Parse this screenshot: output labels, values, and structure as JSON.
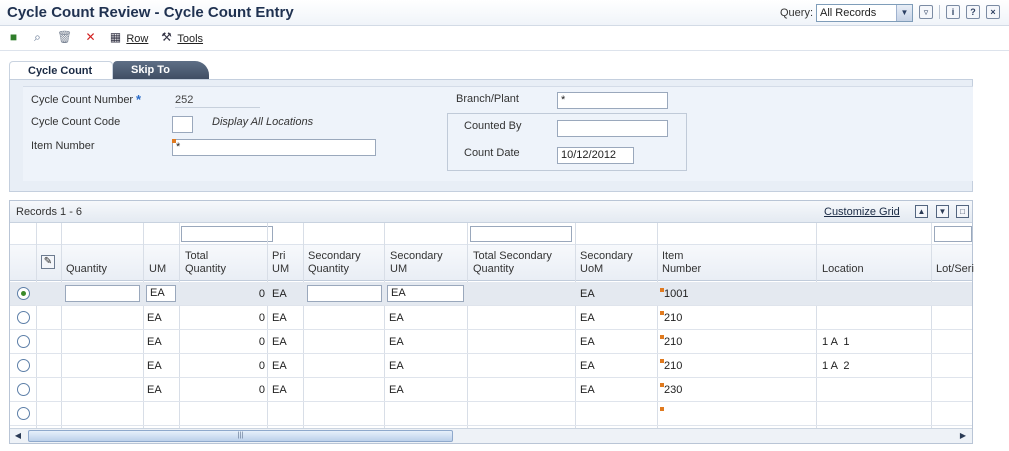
{
  "header": {
    "title": "Cycle Count Review - Cycle Count Entry",
    "query_label": "Query:",
    "query_value": "All Records"
  },
  "toolbar": {
    "row_label": "Row",
    "tools_label": "Tools"
  },
  "tabs": [
    {
      "label": "Cycle Count"
    },
    {
      "label": "Skip To"
    }
  ],
  "form": {
    "cycle_count_number_label": "Cycle Count Number",
    "cycle_count_number_value": "252",
    "cycle_count_code_label": "Cycle Count Code",
    "display_all_locations": "Display All Locations",
    "item_number_label": "Item Number",
    "item_number_value": "*",
    "branch_plant_label": "Branch/Plant",
    "branch_plant_value": "*",
    "counted_by_label": "Counted By",
    "count_date_label": "Count Date",
    "count_date_value": "10/12/2012"
  },
  "grid": {
    "records_label": "Records 1 - 6",
    "customize_label": "Customize Grid",
    "columns": [
      {
        "l1": "",
        "l2": "Quantity"
      },
      {
        "l1": "",
        "l2": "UM"
      },
      {
        "l1": "Total",
        "l2": "Quantity"
      },
      {
        "l1": "Pri",
        "l2": "UM"
      },
      {
        "l1": "Secondary",
        "l2": "Quantity"
      },
      {
        "l1": "Secondary",
        "l2": "UM"
      },
      {
        "l1": "Total Secondary",
        "l2": "Quantity"
      },
      {
        "l1": "Secondary",
        "l2": "UoM"
      },
      {
        "l1": "Item",
        "l2": "Number"
      },
      {
        "l1": "",
        "l2": "Location"
      },
      {
        "l1": "",
        "l2": "Lot/Seri"
      }
    ],
    "rows": [
      {
        "um": "EA",
        "total": "0",
        "pri_um": "EA",
        "sec_um": "EA",
        "sec_uom": "EA",
        "item": "1001",
        "location": ""
      },
      {
        "um": "EA",
        "total": "0",
        "pri_um": "EA",
        "sec_um": "EA",
        "sec_uom": "EA",
        "item": "210",
        "location": ""
      },
      {
        "um": "EA",
        "total": "0",
        "pri_um": "EA",
        "sec_um": "EA",
        "sec_uom": "EA",
        "item": "210",
        "location": "1 A  1"
      },
      {
        "um": "EA",
        "total": "0",
        "pri_um": "EA",
        "sec_um": "EA",
        "sec_uom": "EA",
        "item": "210",
        "location": "1 A  2"
      },
      {
        "um": "EA",
        "total": "0",
        "pri_um": "EA",
        "sec_um": "EA",
        "sec_uom": "EA",
        "item": "230",
        "location": ""
      },
      {
        "um": "",
        "total": "",
        "pri_um": "",
        "sec_um": "",
        "sec_uom": "",
        "item": "",
        "location": ""
      }
    ]
  },
  "colors": {
    "title": "#1f3150",
    "accent": "#2a6bc7",
    "qbe_marker": "#e07a1f"
  }
}
